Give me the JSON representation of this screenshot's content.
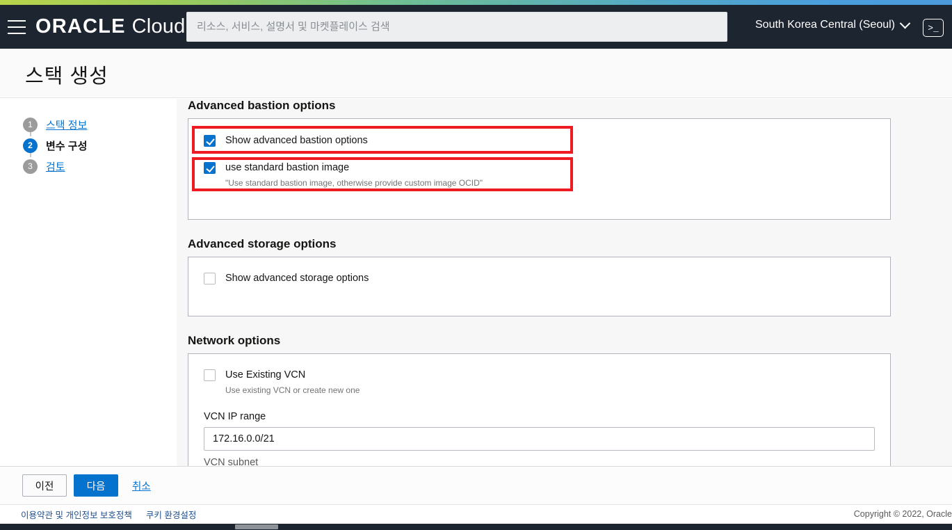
{
  "header": {
    "menu_icon": "hamburger-icon",
    "logo_oracle": "ORACLE",
    "logo_cloud": "Cloud",
    "search_placeholder": "리소스, 서비스, 설명서 및 마켓플레이스 검색",
    "search_value": "",
    "region": "South Korea Central (Seoul)",
    "region_chevron_icon": "chevron-down-icon",
    "cloud_shell_icon": ">_"
  },
  "page": {
    "title": "스택 생성"
  },
  "wizard": {
    "steps": [
      {
        "number": "1",
        "label": "스택 정보",
        "active": false
      },
      {
        "number": "2",
        "label": "변수 구성",
        "active": true
      },
      {
        "number": "3",
        "label": "검토",
        "active": false
      }
    ]
  },
  "sections": {
    "bastion": {
      "title": "Advanced bastion options",
      "checkbox_show": {
        "label": "Show advanced bastion options",
        "checked": true
      },
      "checkbox_image": {
        "label": "use standard bastion image",
        "help": "\"Use standard bastion image, otherwise provide custom image OCID\"",
        "checked": true
      }
    },
    "storage": {
      "title": "Advanced storage options",
      "checkbox_show": {
        "label": "Show advanced storage options",
        "checked": false
      }
    },
    "network": {
      "title": "Network options",
      "checkbox_vcn": {
        "label": "Use Existing VCN",
        "help": "Use existing VCN or create new one",
        "checked": false
      },
      "vcn_ip_range_label": "VCN IP range",
      "vcn_ip_range_value": "172.16.0.0/21",
      "vcn_subnet_label": "VCN subnet"
    }
  },
  "actions": {
    "previous": "이전",
    "next": "다음",
    "cancel": "취소"
  },
  "footer": {
    "terms": "이용약관 및 개인정보 보호정책",
    "cookie": "쿠키 환경설정",
    "copyright": "Copyright © 2022, Oracle"
  },
  "colors": {
    "accent_blue": "#0572ce",
    "header_dark": "#1d2531",
    "annotation_red": "#ee1b22"
  }
}
